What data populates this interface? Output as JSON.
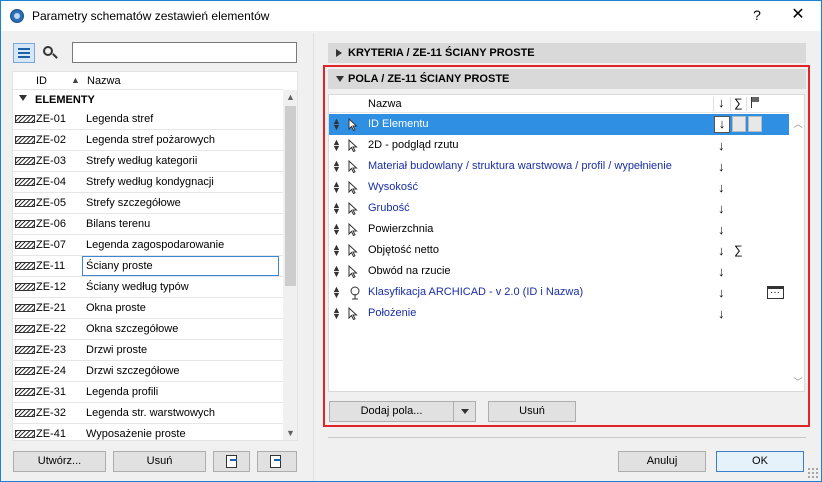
{
  "window": {
    "title": "Parametry schematów zestawień elementów",
    "help_label": "?",
    "close_label": "✕"
  },
  "left_panel": {
    "search_value": "",
    "columns": {
      "id": "ID",
      "sort_glyph": "▲",
      "name": "Nazwa"
    },
    "group_label": "ELEMENTY",
    "rows": [
      {
        "id": "ZE-01",
        "name": "Legenda stref"
      },
      {
        "id": "ZE-02",
        "name": "Legenda stref pożarowych"
      },
      {
        "id": "ZE-03",
        "name": "Strefy według kategorii"
      },
      {
        "id": "ZE-04",
        "name": "Strefy według kondygnacji"
      },
      {
        "id": "ZE-05",
        "name": "Strefy szczegółowe"
      },
      {
        "id": "ZE-06",
        "name": "Bilans terenu"
      },
      {
        "id": "ZE-07",
        "name": "Legenda zagospodarowanie"
      },
      {
        "id": "ZE-11",
        "name": "Ściany proste"
      },
      {
        "id": "ZE-12",
        "name": "Ściany według typów"
      },
      {
        "id": "ZE-21",
        "name": "Okna proste"
      },
      {
        "id": "ZE-22",
        "name": "Okna szczegółowe"
      },
      {
        "id": "ZE-23",
        "name": "Drzwi proste"
      },
      {
        "id": "ZE-24",
        "name": "Drzwi szczegółowe"
      },
      {
        "id": "ZE-31",
        "name": "Legenda profili"
      },
      {
        "id": "ZE-32",
        "name": "Legenda str. warstwowych"
      },
      {
        "id": "ZE-41",
        "name": "Wyposażenie proste"
      }
    ],
    "selected_row": "ZE-11",
    "buttons": {
      "create": "Utwórz...",
      "remove": "Usuń"
    }
  },
  "right_panel": {
    "criteria_bar": "KRYTERIA / ZE-11 ŚCIANY PROSTE",
    "fields_bar": "POLA / ZE-11 ŚCIANY PROSTE",
    "columns": {
      "name": "Nazwa",
      "sort": "↓",
      "sum": "∑"
    },
    "fields": [
      {
        "name": "ID Elementu",
        "arrow": "↓",
        "sum": "",
        "style": "selected"
      },
      {
        "name": "2D - podgląd rzutu",
        "arrow": "↓",
        "sum": "",
        "style": "normal"
      },
      {
        "name": "Materiał budowlany / struktura warstwowa / profil / wypełnienie",
        "arrow": "↓",
        "sum": "",
        "style": "blue"
      },
      {
        "name": "Wysokość",
        "arrow": "↓",
        "sum": "",
        "style": "blue"
      },
      {
        "name": "Grubość",
        "arrow": "↓",
        "sum": "",
        "style": "blue"
      },
      {
        "name": "Powierzchnia",
        "arrow": "↓",
        "sum": "",
        "style": "normal"
      },
      {
        "name": "Objętość netto",
        "arrow": "↓",
        "sum": "∑",
        "style": "normal"
      },
      {
        "name": "Obwód na rzucie",
        "arrow": "↓",
        "sum": "",
        "style": "normal"
      },
      {
        "name": "Klasyfikacja ARCHICAD - v 2.0 (ID i Nazwa)",
        "arrow": "↓",
        "sum": "",
        "style": "blue",
        "icon": "tree-icon",
        "more": true
      },
      {
        "name": "Położenie",
        "arrow": "↓",
        "sum": "",
        "style": "blue"
      }
    ],
    "buttons": {
      "add_fields": "Dodaj pola...",
      "remove": "Usuń"
    }
  },
  "footer": {
    "cancel": "Anuluj",
    "ok": "OK"
  },
  "colors": {
    "selection": "#2f8fe3",
    "highlight_border": "#e0242a",
    "blue_text": "#1a2ea6",
    "window_border": "#1883d7"
  }
}
